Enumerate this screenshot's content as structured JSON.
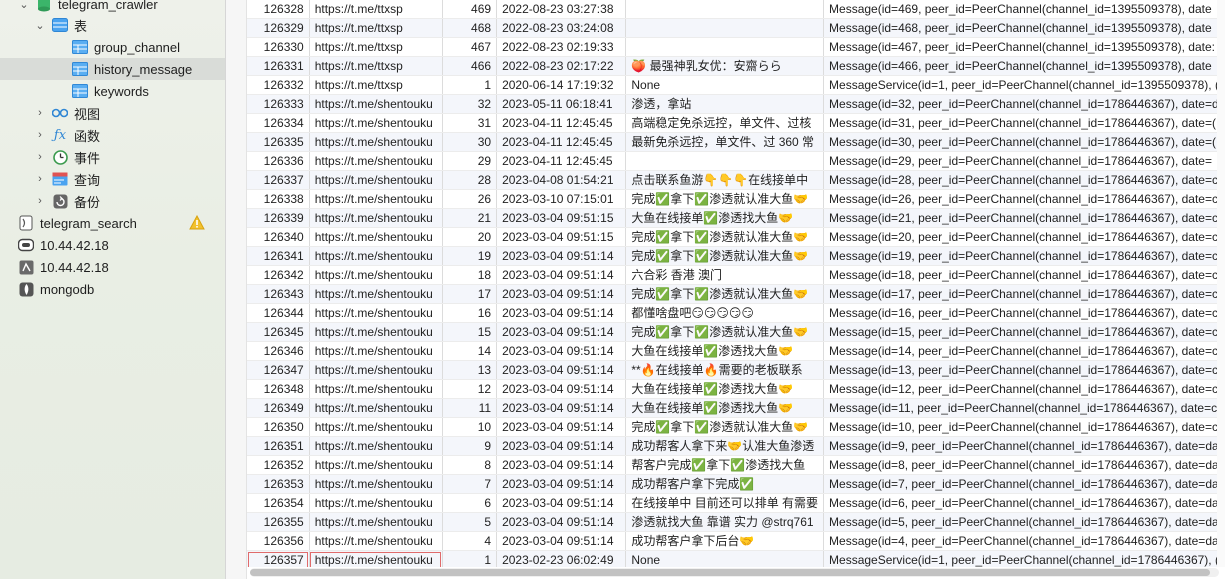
{
  "sidebar": {
    "db_name": "telegram_crawler",
    "tables_label": "表",
    "tables": [
      "group_channel",
      "history_message",
      "keywords"
    ],
    "groups": [
      "视图",
      "函数",
      "事件",
      "查询",
      "备份"
    ],
    "connections": [
      "telegram_search",
      "10.44.42.18",
      "10.44.42.18",
      "mongodb"
    ]
  },
  "rows": [
    {
      "id": "126328",
      "url": "https://t.me/ttxsp",
      "mid": "469",
      "date": "2022-08-23 03:27:38",
      "text": "",
      "raw": "Message(id=469, peer_id=PeerChannel(channel_id=1395509378), date"
    },
    {
      "id": "126329",
      "url": "https://t.me/ttxsp",
      "mid": "468",
      "date": "2022-08-23 03:24:08",
      "text": "",
      "raw": "Message(id=468, peer_id=PeerChannel(channel_id=1395509378), date"
    },
    {
      "id": "126330",
      "url": "https://t.me/ttxsp",
      "mid": "467",
      "date": "2022-08-23 02:19:33",
      "text": "",
      "raw": "Message(id=467, peer_id=PeerChannel(channel_id=1395509378), date:"
    },
    {
      "id": "126331",
      "url": "https://t.me/ttxsp",
      "mid": "466",
      "date": "2022-08-23 02:17:22",
      "text": "🍑 最强神乳女优：安齋らら",
      "raw": "Message(id=466, peer_id=PeerChannel(channel_id=1395509378), date"
    },
    {
      "id": "126332",
      "url": "https://t.me/ttxsp",
      "mid": "1",
      "date": "2020-06-14 17:19:32",
      "text": "None",
      "raw": "MessageService(id=1, peer_id=PeerChannel(channel_id=1395509378), ("
    },
    {
      "id": "126333",
      "url": "https://t.me/shentouku",
      "mid": "32",
      "date": "2023-05-11 06:18:41",
      "text": "渗透，拿站",
      "raw": "Message(id=32, peer_id=PeerChannel(channel_id=1786446367), date=d"
    },
    {
      "id": "126334",
      "url": "https://t.me/shentouku",
      "mid": "31",
      "date": "2023-04-11 12:45:45",
      "text": "高端稳定免杀远控，单文件、过核",
      "raw": "Message(id=31, peer_id=PeerChannel(channel_id=1786446367), date=("
    },
    {
      "id": "126335",
      "url": "https://t.me/shentouku",
      "mid": "30",
      "date": "2023-04-11 12:45:45",
      "text": "最新免杀远控，单文件、过 360 常",
      "raw": "Message(id=30, peer_id=PeerChannel(channel_id=1786446367), date=("
    },
    {
      "id": "126336",
      "url": "https://t.me/shentouku",
      "mid": "29",
      "date": "2023-04-11 12:45:45",
      "text": "",
      "raw": "Message(id=29, peer_id=PeerChannel(channel_id=1786446367), date="
    },
    {
      "id": "126337",
      "url": "https://t.me/shentouku",
      "mid": "28",
      "date": "2023-04-08 01:54:21",
      "text": "点击联系鱼游👇👇👇在线接单中",
      "raw": "Message(id=28, peer_id=PeerChannel(channel_id=1786446367), date=c"
    },
    {
      "id": "126338",
      "url": "https://t.me/shentouku",
      "mid": "26",
      "date": "2023-03-10 07:15:01",
      "text": "完成✅拿下✅渗透就认准大鱼🤝",
      "raw": "Message(id=26, peer_id=PeerChannel(channel_id=1786446367), date=c"
    },
    {
      "id": "126339",
      "url": "https://t.me/shentouku",
      "mid": "21",
      "date": "2023-03-04 09:51:15",
      "text": "大鱼在线接单✅渗透找大鱼🤝",
      "raw": "Message(id=21, peer_id=PeerChannel(channel_id=1786446367), date=c"
    },
    {
      "id": "126340",
      "url": "https://t.me/shentouku",
      "mid": "20",
      "date": "2023-03-04 09:51:15",
      "text": "完成✅拿下✅渗透就认准大鱼🤝",
      "raw": "Message(id=20, peer_id=PeerChannel(channel_id=1786446367), date=c"
    },
    {
      "id": "126341",
      "url": "https://t.me/shentouku",
      "mid": "19",
      "date": "2023-03-04 09:51:14",
      "text": "完成✅拿下✅渗透就认准大鱼🤝",
      "raw": "Message(id=19, peer_id=PeerChannel(channel_id=1786446367), date=c"
    },
    {
      "id": "126342",
      "url": "https://t.me/shentouku",
      "mid": "18",
      "date": "2023-03-04 09:51:14",
      "text": "六合彩 香港 澳门",
      "raw": "Message(id=18, peer_id=PeerChannel(channel_id=1786446367), date=c"
    },
    {
      "id": "126343",
      "url": "https://t.me/shentouku",
      "mid": "17",
      "date": "2023-03-04 09:51:14",
      "text": "完成✅拿下✅渗透就认准大鱼🤝",
      "raw": "Message(id=17, peer_id=PeerChannel(channel_id=1786446367), date=c"
    },
    {
      "id": "126344",
      "url": "https://t.me/shentouku",
      "mid": "16",
      "date": "2023-03-04 09:51:14",
      "text": "都懂啥盘吧😏😏😏😏😏",
      "raw": "Message(id=16, peer_id=PeerChannel(channel_id=1786446367), date=c"
    },
    {
      "id": "126345",
      "url": "https://t.me/shentouku",
      "mid": "15",
      "date": "2023-03-04 09:51:14",
      "text": "完成✅拿下✅渗透就认准大鱼🤝",
      "raw": "Message(id=15, peer_id=PeerChannel(channel_id=1786446367), date=c"
    },
    {
      "id": "126346",
      "url": "https://t.me/shentouku",
      "mid": "14",
      "date": "2023-03-04 09:51:14",
      "text": "大鱼在线接单✅渗透找大鱼🤝",
      "raw": "Message(id=14, peer_id=PeerChannel(channel_id=1786446367), date=c"
    },
    {
      "id": "126347",
      "url": "https://t.me/shentouku",
      "mid": "13",
      "date": "2023-03-04 09:51:14",
      "text": "**🔥在线接单🔥需要的老板联系",
      "raw": "Message(id=13, peer_id=PeerChannel(channel_id=1786446367), date=c"
    },
    {
      "id": "126348",
      "url": "https://t.me/shentouku",
      "mid": "12",
      "date": "2023-03-04 09:51:14",
      "text": "大鱼在线接单✅渗透找大鱼🤝",
      "raw": "Message(id=12, peer_id=PeerChannel(channel_id=1786446367), date=c"
    },
    {
      "id": "126349",
      "url": "https://t.me/shentouku",
      "mid": "11",
      "date": "2023-03-04 09:51:14",
      "text": "大鱼在线接单✅渗透找大鱼🤝",
      "raw": "Message(id=11, peer_id=PeerChannel(channel_id=1786446367), date=c"
    },
    {
      "id": "126350",
      "url": "https://t.me/shentouku",
      "mid": "10",
      "date": "2023-03-04 09:51:14",
      "text": "完成✅拿下✅渗透就认准大鱼🤝",
      "raw": "Message(id=10, peer_id=PeerChannel(channel_id=1786446367), date=c"
    },
    {
      "id": "126351",
      "url": "https://t.me/shentouku",
      "mid": "9",
      "date": "2023-03-04 09:51:14",
      "text": "成功帮客人拿下来🤝认准大鱼渗透",
      "raw": "Message(id=9, peer_id=PeerChannel(channel_id=1786446367), date=da"
    },
    {
      "id": "126352",
      "url": "https://t.me/shentouku",
      "mid": "8",
      "date": "2023-03-04 09:51:14",
      "text": "帮客户完成✅拿下✅渗透找大鱼",
      "raw": "Message(id=8, peer_id=PeerChannel(channel_id=1786446367), date=da"
    },
    {
      "id": "126353",
      "url": "https://t.me/shentouku",
      "mid": "7",
      "date": "2023-03-04 09:51:14",
      "text": "成功帮客户拿下完成✅",
      "raw": "Message(id=7, peer_id=PeerChannel(channel_id=1786446367), date=da"
    },
    {
      "id": "126354",
      "url": "https://t.me/shentouku",
      "mid": "6",
      "date": "2023-03-04 09:51:14",
      "text": "在线接单中 目前还可以排单 有需要",
      "raw": "Message(id=6, peer_id=PeerChannel(channel_id=1786446367), date=da"
    },
    {
      "id": "126355",
      "url": "https://t.me/shentouku",
      "mid": "5",
      "date": "2023-03-04 09:51:14",
      "text": "渗透就找大鱼 靠谱 实力 @strq761",
      "raw": "Message(id=5, peer_id=PeerChannel(channel_id=1786446367), date=da"
    },
    {
      "id": "126356",
      "url": "https://t.me/shentouku",
      "mid": "4",
      "date": "2023-03-04 09:51:14",
      "text": "成功帮客户拿下后台🤝",
      "raw": "Message(id=4, peer_id=PeerChannel(channel_id=1786446367), date=da"
    },
    {
      "id": "126357",
      "url": "https://t.me/shentouku",
      "mid": "1",
      "date": "2023-02-23 06:02:49",
      "text": "None",
      "raw": "MessageService(id=1, peer_id=PeerChannel(channel_id=1786446367), ("
    }
  ]
}
